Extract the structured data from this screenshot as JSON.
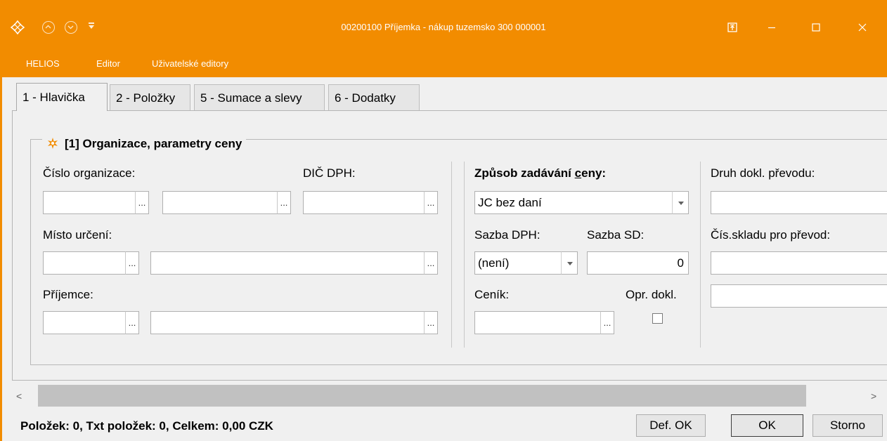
{
  "window": {
    "title": "00200100  Příjemka - nákup tuzemsko  300 000001",
    "accent_color": "#f28c00"
  },
  "menu": [
    "HELIOS",
    "Editor",
    "Uživatelské editory"
  ],
  "tabs": [
    "1 - Hlavička",
    "2 - Položky",
    "5 - Sumace a slevy",
    "6 - Dodatky"
  ],
  "group": {
    "title": "[1] Organizace, parametry ceny"
  },
  "left": {
    "cislo_organizace_label": "Číslo organizace:",
    "dic_dph_label": "DIČ DPH:",
    "misto_urceni_label": "Místo určení:",
    "prijemce_label": "Příjemce:",
    "dots": "..."
  },
  "middle": {
    "zpusob_label_pre": "Způsob zadávání ",
    "zpusob_label_u": "c",
    "zpusob_label_post": "eny:",
    "zpusob_value": "JC bez daní",
    "sazba_dph_label": "Sazba DPH:",
    "sazba_dph_value": "(není)",
    "sazba_sd_label": "Sazba SD:",
    "sazba_sd_value": "0",
    "cenik_label": "Ceník:",
    "opr_dokl_label": "Opr. dokl."
  },
  "right": {
    "druh_label": "Druh dokl. převodu:",
    "cis_skladu_label": "Čís.skladu pro převod:"
  },
  "status": {
    "summary": "Položek: 0,  Txt položek: 0,  Celkem: 0,00 CZK"
  },
  "buttons": {
    "def_ok": "Def. OK",
    "ok": "OK",
    "storno": "Storno"
  },
  "scroll_arrows": {
    "left": "<",
    "right": ">"
  }
}
